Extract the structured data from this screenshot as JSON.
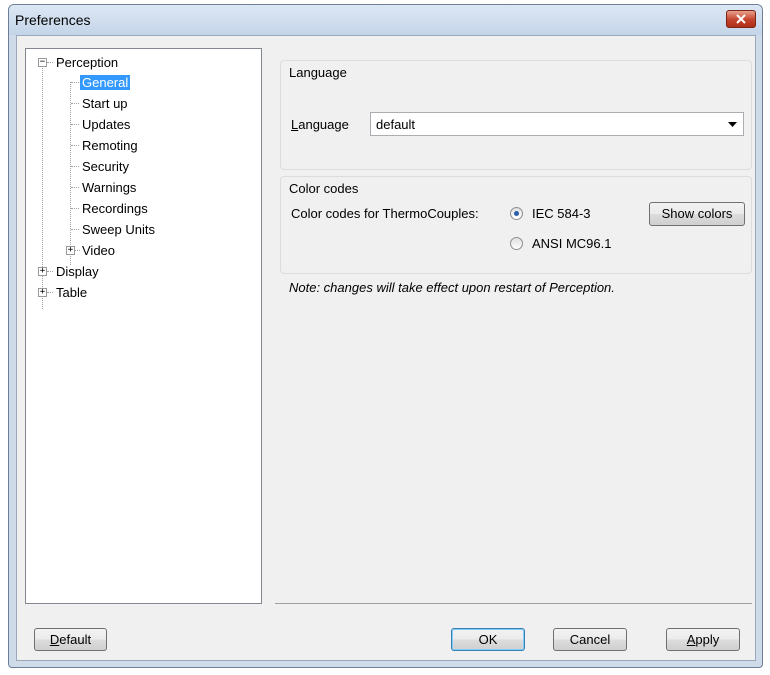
{
  "window": {
    "title": "Preferences"
  },
  "tree": {
    "root": "Perception",
    "children": [
      "General",
      "Start up",
      "Updates",
      "Remoting",
      "Security",
      "Warnings",
      "Recordings",
      "Sweep Units",
      "Video"
    ],
    "siblings": [
      "Display",
      "Table"
    ],
    "selected": "General"
  },
  "language_group": {
    "title": "Language",
    "label_accel": "L",
    "label_rest": "anguage",
    "value": "default"
  },
  "color_group": {
    "title": "Color codes",
    "label": "Color codes for ThermoCouples:",
    "options": [
      "IEC 584-3",
      "ANSI MC96.1"
    ],
    "selected": "IEC 584-3",
    "show_colors": "Show colors"
  },
  "note": "Note: changes will take effect upon restart of Perception.",
  "buttons": {
    "default_accel": "D",
    "default_rest": "efault",
    "ok": "OK",
    "cancel": "Cancel",
    "apply_accel": "A",
    "apply_rest": "pply"
  },
  "colors": {
    "selection": "#3399ff",
    "close": "#c4432c"
  }
}
